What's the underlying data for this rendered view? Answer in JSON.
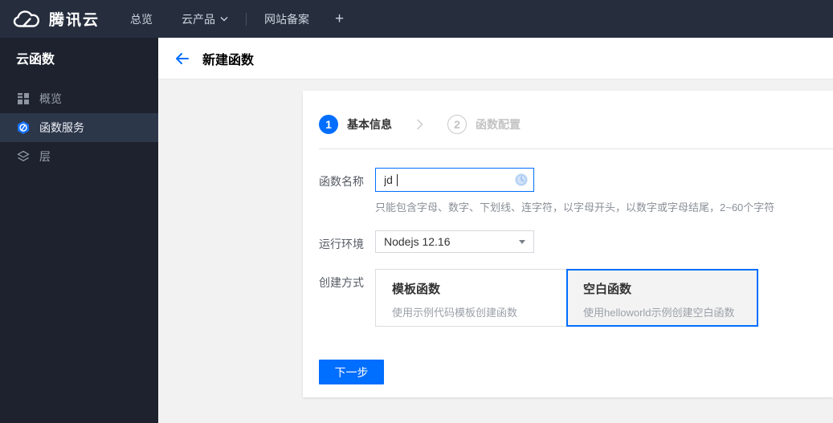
{
  "topbar": {
    "brand": "腾讯云",
    "nav_overview": "总览",
    "nav_products": "云产品",
    "nav_icp": "网站备案",
    "nav_plus": "+"
  },
  "sidebar": {
    "title": "云函数",
    "items": [
      {
        "label": "概览",
        "icon": "grid-icon",
        "active": false
      },
      {
        "label": "函数服务",
        "icon": "scf-hexagon-icon",
        "active": true
      },
      {
        "label": "层",
        "icon": "layers-icon",
        "active": false
      }
    ]
  },
  "page": {
    "title": "新建函数"
  },
  "steps": [
    {
      "num": "1",
      "label": "基本信息",
      "active": true
    },
    {
      "num": "2",
      "label": "函数配置",
      "active": false
    }
  ],
  "form": {
    "name_label": "函数名称",
    "name_value": "jd",
    "name_hint": "只能包含字母、数字、下划线、连字符，以字母开头，以数字或字母结尾，2~60个字符",
    "runtime_label": "运行环境",
    "runtime_value": "Nodejs 12.16",
    "method_label": "创建方式",
    "methods": [
      {
        "title": "模板函数",
        "desc": "使用示例代码模板创建函数",
        "selected": false
      },
      {
        "title": "空白函数",
        "desc": "使用helloworld示例创建空白函数",
        "selected": true
      }
    ],
    "next_button": "下一步"
  },
  "colors": {
    "accent": "#006eff",
    "topbar_bg": "#262e3e",
    "sidebar_bg": "#1d222e",
    "sidebar_active_bg": "#2d374a",
    "selected_card_bg": "#f3f3f3"
  }
}
